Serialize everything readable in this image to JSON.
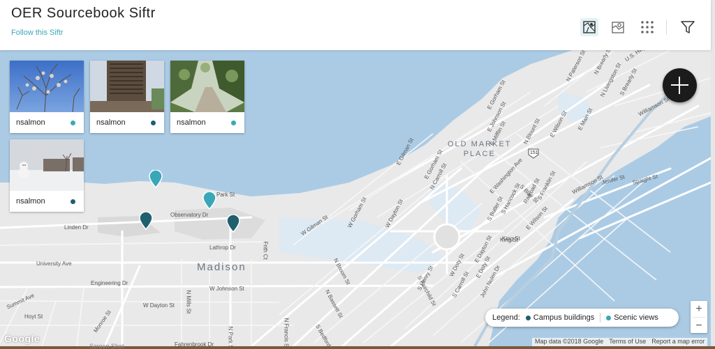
{
  "header": {
    "title": "OER Sourcebook Siftr",
    "follow_link": "Follow this Siftr",
    "tools": [
      "map-view-icon",
      "map-thumbnail-icon",
      "grid-view-icon",
      "filter-icon"
    ]
  },
  "cards": [
    {
      "author": "nsalmon",
      "dot_color": "#3aa7b9"
    },
    {
      "author": "nsalmon",
      "dot_color": "#1f5f6e"
    },
    {
      "author": "nsalmon",
      "dot_color": "#3aa7b9"
    },
    {
      "author": "nsalmon",
      "dot_color": "#1f5f6e"
    }
  ],
  "map": {
    "place_labels": {
      "old_market_line1": "OLD MARKET",
      "old_market_line2": "PLACE",
      "madison": "Madison"
    },
    "street_labels": [
      "E Gorham St",
      "E Johnson St",
      "N Livingston St",
      "E Mifflin St",
      "E Washington Ave",
      "S Blair St",
      "Williamson St",
      "Williamson St",
      "Jenifer St",
      "Spaight St",
      "King St",
      "E Wilson St",
      "John Nolen Dr",
      "W Doty St",
      "W Dayton St",
      "W Johnson St",
      "W Gorham St",
      "N Broom St",
      "N Bassett St",
      "S Fairchild St",
      "W Gilman St",
      "Observatory Dr",
      "Linden Dr",
      "University Ave",
      "Engineering Dr",
      "W Dayton St",
      "N Park St",
      "Monroe St",
      "Fahrenbrook Dr",
      "Summit Ave",
      "Hoyt St",
      "N Mills St",
      "Lathrop Dr",
      "Frith Ct",
      "N Francis St",
      "S Bedford St",
      "King St",
      "E Dayton St",
      "Railroad St",
      "E Main St",
      "S Butler St",
      "S Hancock St",
      "S Franklin St",
      "N Blount St",
      "E Wilson St",
      "N Paterson St",
      "N Brearly St",
      "S Brearly St",
      "U.S. Hwy",
      "Park St",
      "E Gilman St",
      "E Gorham St",
      "N Carroll St",
      "S Henry St",
      "E Doty St",
      "S Carroll St"
    ],
    "route_shield": "151",
    "pins": [
      {
        "color": "#3aa7b9"
      },
      {
        "color": "#3aa7b9"
      },
      {
        "color": "#1f5f6e"
      },
      {
        "color": "#1f5f6e"
      }
    ]
  },
  "legend": {
    "label": "Legend:",
    "items": [
      {
        "name": "Campus buildings",
        "color": "#1f5f6e"
      },
      {
        "name": "Scenic views",
        "color": "#3aa7b9"
      }
    ]
  },
  "zoom": {
    "in": "+",
    "out": "−"
  },
  "attribution": {
    "map_data": "Map data ©2018 Google",
    "terms": "Terms of Use",
    "report": "Report a map error"
  },
  "google_logo": "Google",
  "screenshot_tag": "Screen Shot",
  "colors": {
    "water": "#abcbe5",
    "land": "#e9e9e9",
    "accent_teal": "#3aa7b9",
    "dark_teal": "#1f5f6e"
  }
}
